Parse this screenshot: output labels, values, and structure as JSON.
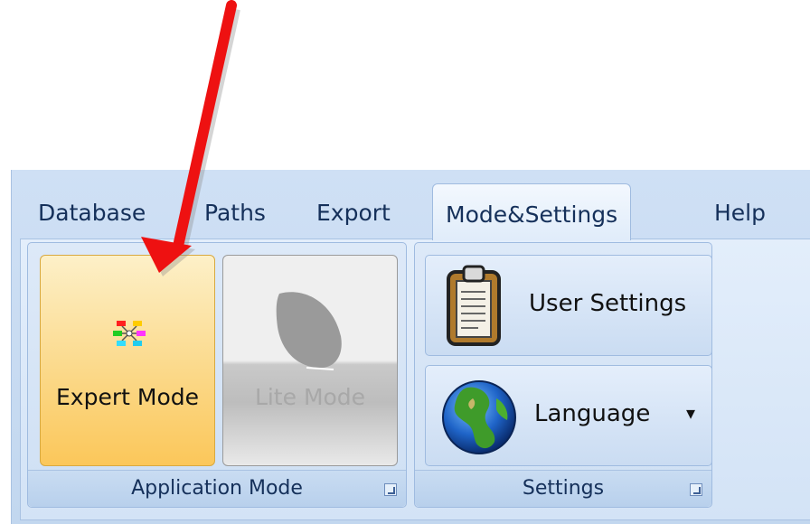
{
  "tabs": [
    "Database",
    "Paths",
    "Export",
    "Mode&Settings",
    "Help"
  ],
  "active_tab": "Mode&Settings",
  "groups": {
    "application_mode": {
      "label": "Application Mode",
      "buttons": {
        "expert": {
          "label": "Expert Mode",
          "icon": "network-nodes-icon",
          "state": "selected"
        },
        "lite": {
          "label": "Lite Mode",
          "icon": "leaf-icon",
          "state": "disabled"
        }
      }
    },
    "settings": {
      "label": "Settings",
      "buttons": {
        "user_settings": {
          "label": "User Settings",
          "icon": "clipboard-icon"
        },
        "language": {
          "label": "Language",
          "icon": "globe-icon",
          "dropdown_glyph": "▾"
        }
      }
    }
  },
  "annotation": {
    "type": "red-arrow",
    "color": "#ee1111",
    "points_to": "Expert Mode"
  }
}
